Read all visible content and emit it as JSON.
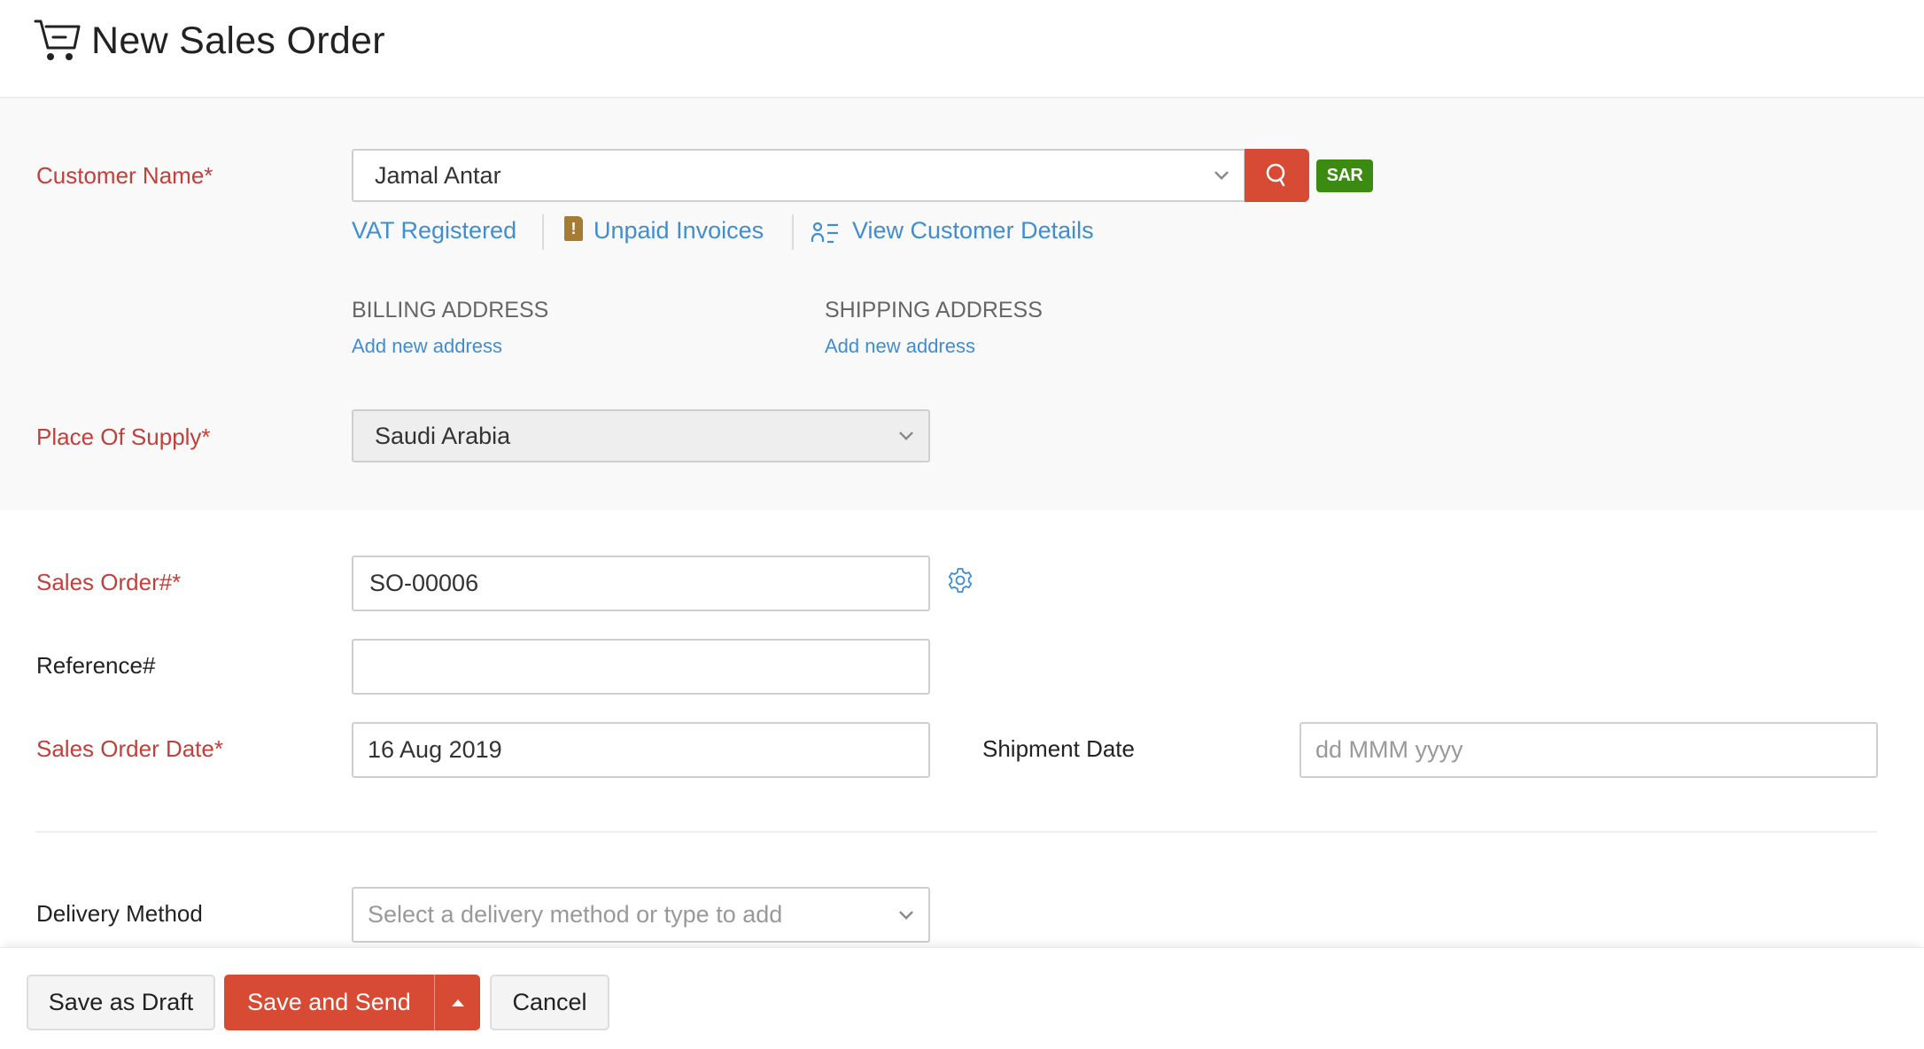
{
  "header": {
    "icon": "shopping-cart-icon",
    "title": "New Sales Order"
  },
  "customer": {
    "label": "Customer Name*",
    "value": "Jamal Antar",
    "search_icon": "search-icon",
    "currency_badge": "SAR",
    "links": {
      "vat": "VAT Registered",
      "unpaid_icon": "!",
      "unpaid": "Unpaid Invoices",
      "details": "View Customer Details"
    }
  },
  "addresses": {
    "billing": {
      "heading": "BILLING ADDRESS",
      "link": "Add new address"
    },
    "shipping": {
      "heading": "SHIPPING ADDRESS",
      "link": "Add new address"
    }
  },
  "place_of_supply": {
    "label": "Place Of Supply*",
    "value": "Saudi Arabia"
  },
  "sales_order_number": {
    "label": "Sales Order#*",
    "value": "SO-00006"
  },
  "reference": {
    "label": "Reference#",
    "value": ""
  },
  "sales_order_date": {
    "label": "Sales Order Date*",
    "value": "16 Aug 2019"
  },
  "shipment_date": {
    "label": "Shipment Date",
    "placeholder": "dd MMM yyyy"
  },
  "delivery_method": {
    "label": "Delivery Method",
    "placeholder": "Select a delivery method or type to add"
  },
  "footer": {
    "save_draft": "Save as Draft",
    "save_send": "Save and Send",
    "cancel": "Cancel"
  },
  "colors": {
    "required_label": "#c0403b",
    "link": "#408dd1",
    "primary": "#d74a33",
    "badge": "#3b8a11",
    "warning_icon": "#a57c33"
  }
}
